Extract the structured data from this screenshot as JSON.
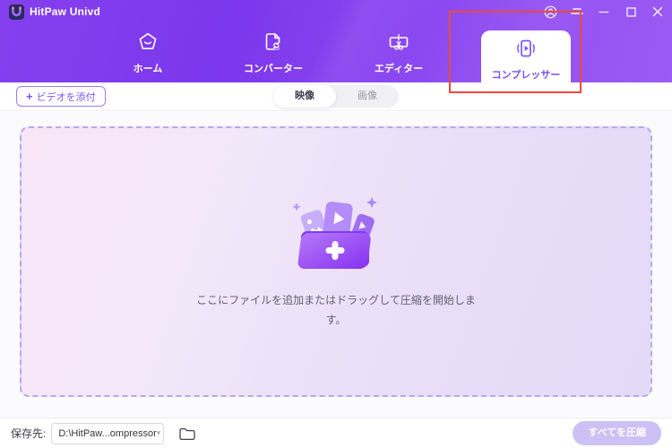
{
  "window": {
    "title": "HitPaw Univd"
  },
  "titlebar": {
    "icons": [
      "account-icon",
      "menu-icon",
      "minimize-icon",
      "maximize-icon",
      "close-icon"
    ]
  },
  "nav": {
    "tabs": [
      {
        "label": "ホーム",
        "icon": "home-icon",
        "active": false
      },
      {
        "label": "コンバーター",
        "icon": "converter-icon",
        "active": false
      },
      {
        "label": "エディター",
        "icon": "editor-icon",
        "active": false
      },
      {
        "label": "コンプレッサー",
        "icon": "compressor-icon",
        "active": true
      }
    ]
  },
  "toolbar": {
    "attach_plus": "+",
    "attach_label": "ビデオを添付",
    "toggle": [
      {
        "label": "映像",
        "selected": true
      },
      {
        "label": "画像",
        "selected": false
      }
    ]
  },
  "dropzone": {
    "hint": "ここにファイルを追加またはドラッグして圧縮を開始します。"
  },
  "footer": {
    "save_label": "保存先:",
    "path_value": "D:\\HitPaw...ompressor",
    "compress_label": "すべてを圧縮"
  },
  "annotation": {
    "type": "highlight-rectangle",
    "color": "#e94b3c"
  },
  "colors": {
    "header_purple": "#8440ef",
    "accent_purple": "#7a50f0",
    "highlight_red": "#e94b3c",
    "disabled_button": "#cdc0f4",
    "dropzone_border": "#b7a7ed"
  }
}
